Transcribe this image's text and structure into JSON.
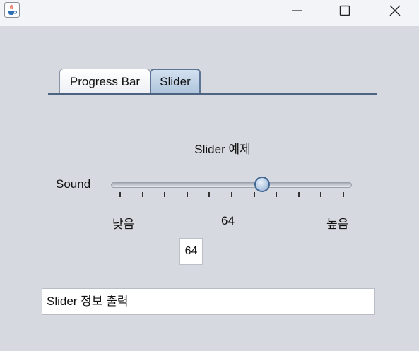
{
  "window": {
    "icon": "java-cup-icon",
    "controls": [
      "minimize-icon",
      "maximize-icon",
      "close-icon"
    ]
  },
  "tabs": [
    {
      "label": "Progress Bar",
      "selected": false
    },
    {
      "label": "Slider",
      "selected": true
    }
  ],
  "slider_panel": {
    "title": "Slider 예제",
    "slider_label": "Sound",
    "value": 64,
    "min": 0,
    "max": 100,
    "labels": {
      "low": "낮음",
      "mid": "64",
      "high": "높음"
    },
    "value_box": "64"
  },
  "info_field": {
    "value": "Slider 정보 출력"
  },
  "colors": {
    "background": "#d6d9e0",
    "selected_tab": "#aec4db",
    "accent": "#3f6591"
  }
}
